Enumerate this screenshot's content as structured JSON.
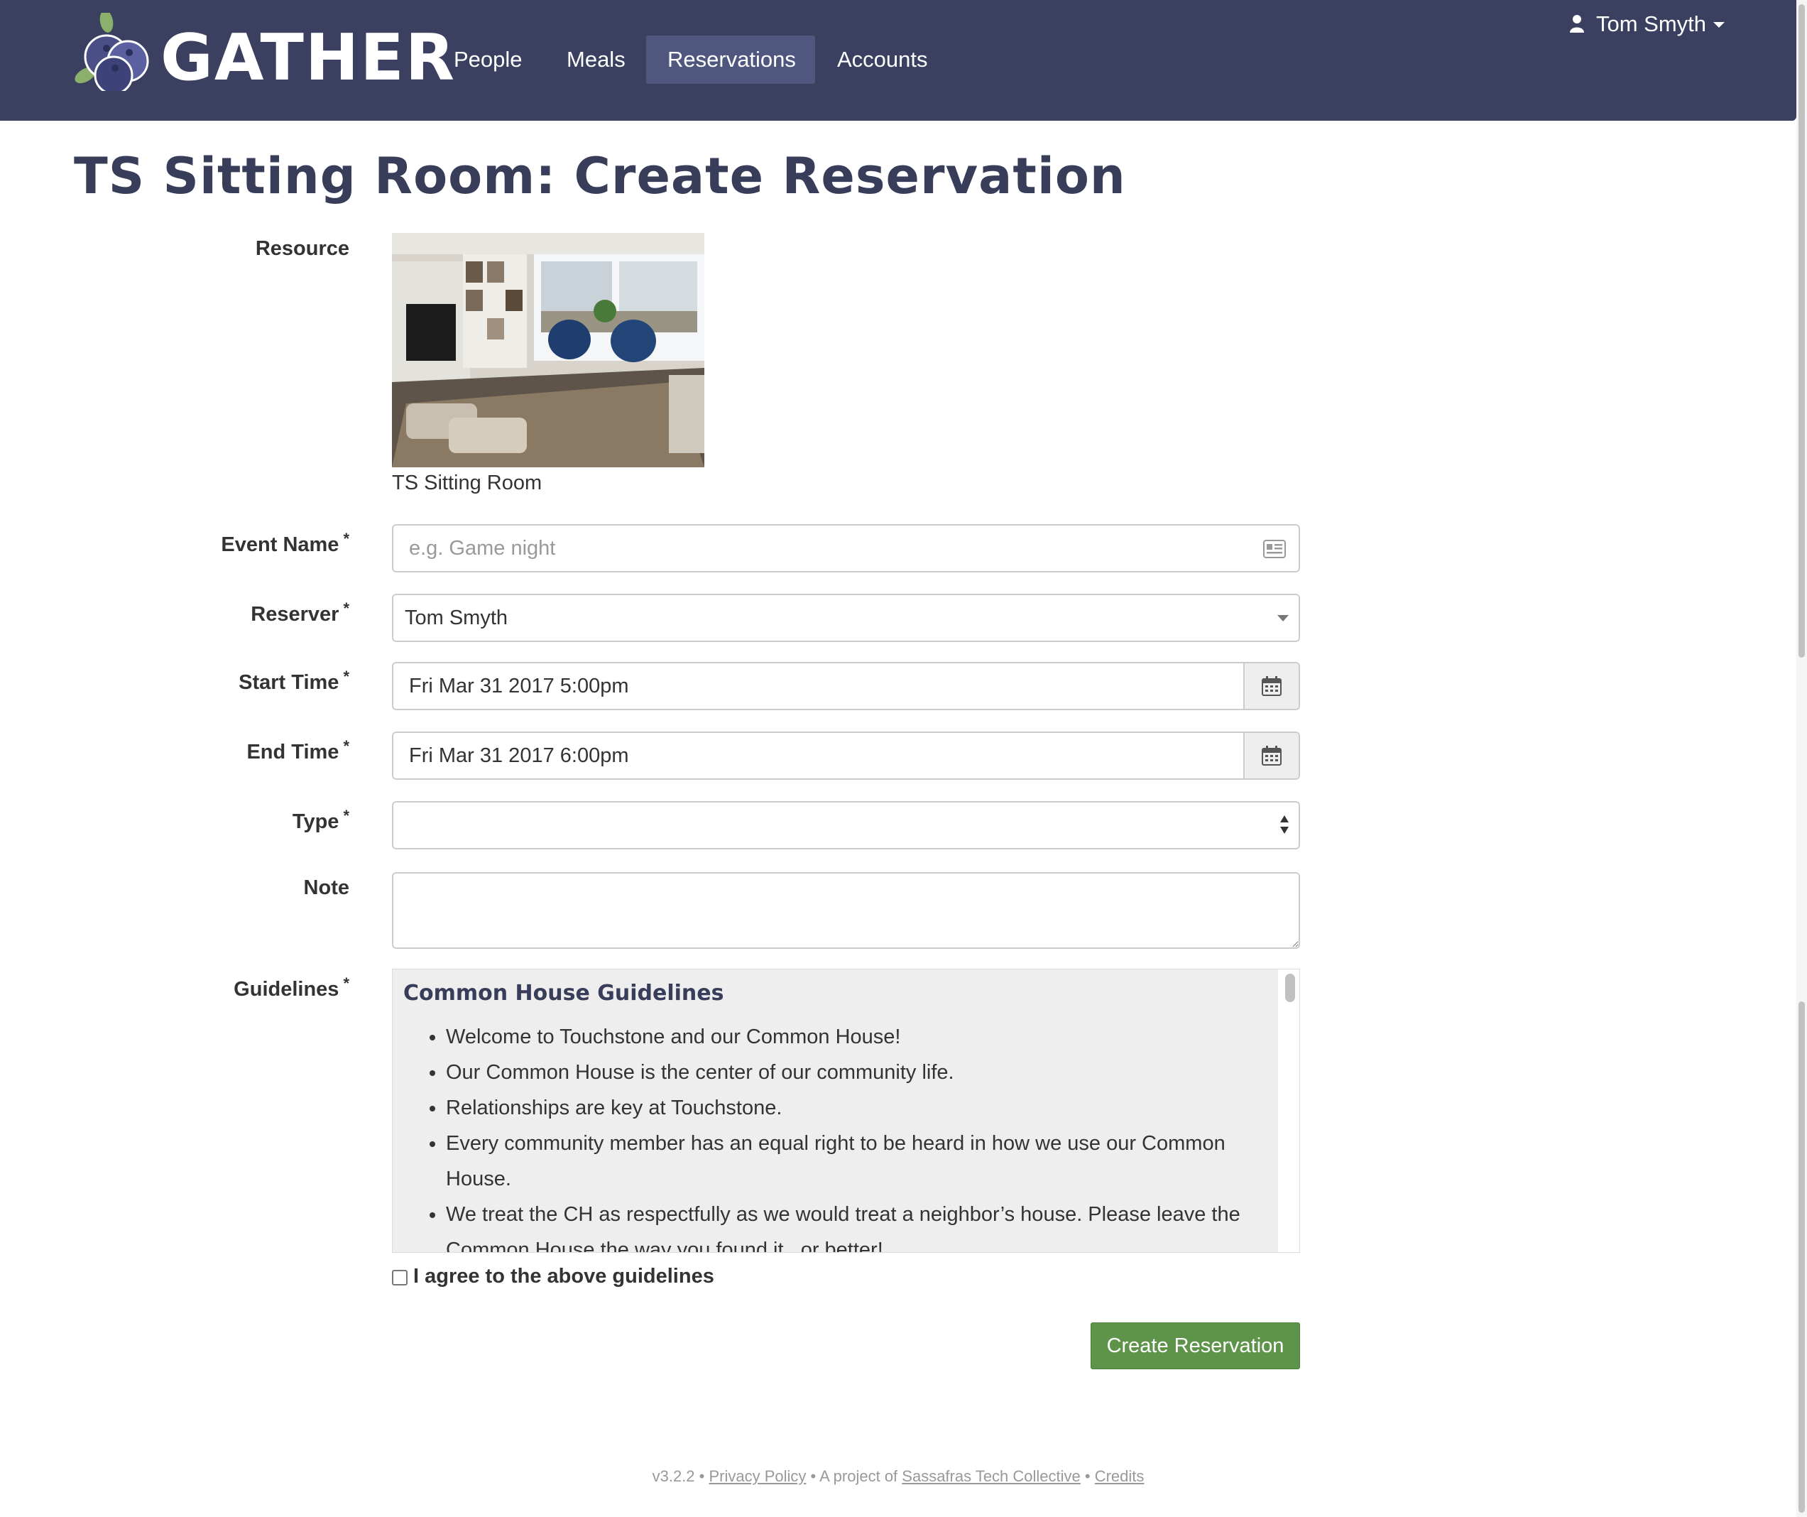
{
  "brand": {
    "name": "GATHER"
  },
  "nav": {
    "items": [
      {
        "label": "People"
      },
      {
        "label": "Meals"
      },
      {
        "label": "Reservations",
        "active": true
      },
      {
        "label": "Accounts"
      }
    ],
    "user": {
      "name": "Tom Smyth"
    }
  },
  "page": {
    "title": "TS Sitting Room: Create Reservation"
  },
  "form": {
    "resource": {
      "label": "Resource",
      "caption": "TS Sitting Room",
      "image": "sitting-room-photo"
    },
    "event_name": {
      "label": "Event Name",
      "required": "*",
      "placeholder": "e.g. Game night",
      "value": ""
    },
    "reserver": {
      "label": "Reserver",
      "required": "*",
      "value": "Tom Smyth"
    },
    "start_time": {
      "label": "Start Time",
      "required": "*",
      "value": "Fri Mar 31 2017 5:00pm"
    },
    "end_time": {
      "label": "End Time",
      "required": "*",
      "value": "Fri Mar 31 2017 6:00pm"
    },
    "type": {
      "label": "Type",
      "required": "*",
      "value": ""
    },
    "note": {
      "label": "Note",
      "value": ""
    },
    "guidelines": {
      "label": "Guidelines",
      "required": "*",
      "title": "Common House Guidelines",
      "items": [
        "Welcome to Touchstone and our Common House!",
        "Our Common House is the center of our community life.",
        "Relationships are key at Touchstone.",
        "Every community member has an equal right to be heard in how we use our Common House.",
        "We treat the CH as respectfully as we would treat a neighbor’s house. Please leave the Common House the way you found it...or better!"
      ]
    },
    "agree": {
      "label": "I agree to the above guidelines",
      "checked": false
    },
    "submit": {
      "label": "Create Reservation"
    }
  },
  "footer": {
    "version": "v3.2.2",
    "sep1": " • ",
    "privacy": "Privacy Policy",
    "project_prefix": " • A project of ",
    "collective": "Sassafras Tech Collective",
    "sep2": " • ",
    "credits": "Credits"
  },
  "colors": {
    "navbar": "#3b4060",
    "nav_active": "#50577e",
    "title": "#383d5a",
    "submit": "#5e9449",
    "guidelines_bg": "#eeeeee"
  },
  "icons": {
    "event_name": "id-card-icon",
    "start_time": "calendar-icon",
    "end_time": "calendar-icon",
    "user": "user-icon",
    "logo": "blueberry-logo-icon"
  }
}
